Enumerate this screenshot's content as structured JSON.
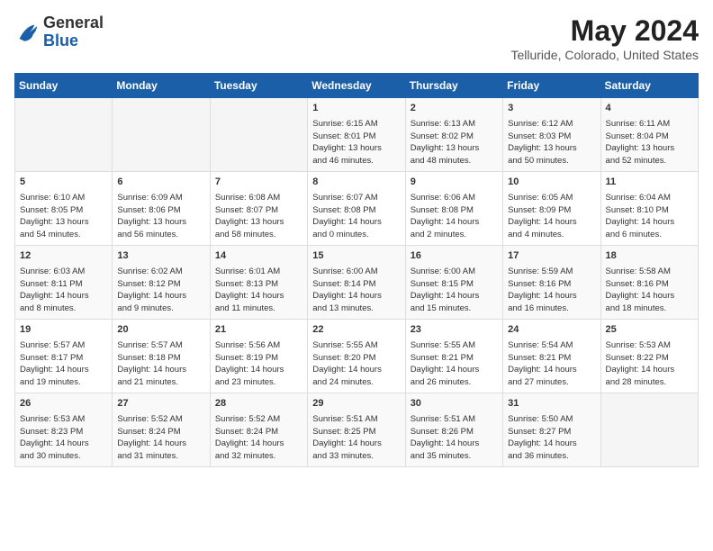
{
  "app": {
    "logo_line1": "General",
    "logo_line2": "Blue",
    "title": "May 2024",
    "subtitle": "Telluride, Colorado, United States"
  },
  "calendar": {
    "headers": [
      "Sunday",
      "Monday",
      "Tuesday",
      "Wednesday",
      "Thursday",
      "Friday",
      "Saturday"
    ],
    "weeks": [
      [
        {
          "day": "",
          "info": ""
        },
        {
          "day": "",
          "info": ""
        },
        {
          "day": "",
          "info": ""
        },
        {
          "day": "1",
          "info": "Sunrise: 6:15 AM\nSunset: 8:01 PM\nDaylight: 13 hours\nand 46 minutes."
        },
        {
          "day": "2",
          "info": "Sunrise: 6:13 AM\nSunset: 8:02 PM\nDaylight: 13 hours\nand 48 minutes."
        },
        {
          "day": "3",
          "info": "Sunrise: 6:12 AM\nSunset: 8:03 PM\nDaylight: 13 hours\nand 50 minutes."
        },
        {
          "day": "4",
          "info": "Sunrise: 6:11 AM\nSunset: 8:04 PM\nDaylight: 13 hours\nand 52 minutes."
        }
      ],
      [
        {
          "day": "5",
          "info": "Sunrise: 6:10 AM\nSunset: 8:05 PM\nDaylight: 13 hours\nand 54 minutes."
        },
        {
          "day": "6",
          "info": "Sunrise: 6:09 AM\nSunset: 8:06 PM\nDaylight: 13 hours\nand 56 minutes."
        },
        {
          "day": "7",
          "info": "Sunrise: 6:08 AM\nSunset: 8:07 PM\nDaylight: 13 hours\nand 58 minutes."
        },
        {
          "day": "8",
          "info": "Sunrise: 6:07 AM\nSunset: 8:08 PM\nDaylight: 14 hours\nand 0 minutes."
        },
        {
          "day": "9",
          "info": "Sunrise: 6:06 AM\nSunset: 8:08 PM\nDaylight: 14 hours\nand 2 minutes."
        },
        {
          "day": "10",
          "info": "Sunrise: 6:05 AM\nSunset: 8:09 PM\nDaylight: 14 hours\nand 4 minutes."
        },
        {
          "day": "11",
          "info": "Sunrise: 6:04 AM\nSunset: 8:10 PM\nDaylight: 14 hours\nand 6 minutes."
        }
      ],
      [
        {
          "day": "12",
          "info": "Sunrise: 6:03 AM\nSunset: 8:11 PM\nDaylight: 14 hours\nand 8 minutes."
        },
        {
          "day": "13",
          "info": "Sunrise: 6:02 AM\nSunset: 8:12 PM\nDaylight: 14 hours\nand 9 minutes."
        },
        {
          "day": "14",
          "info": "Sunrise: 6:01 AM\nSunset: 8:13 PM\nDaylight: 14 hours\nand 11 minutes."
        },
        {
          "day": "15",
          "info": "Sunrise: 6:00 AM\nSunset: 8:14 PM\nDaylight: 14 hours\nand 13 minutes."
        },
        {
          "day": "16",
          "info": "Sunrise: 6:00 AM\nSunset: 8:15 PM\nDaylight: 14 hours\nand 15 minutes."
        },
        {
          "day": "17",
          "info": "Sunrise: 5:59 AM\nSunset: 8:16 PM\nDaylight: 14 hours\nand 16 minutes."
        },
        {
          "day": "18",
          "info": "Sunrise: 5:58 AM\nSunset: 8:16 PM\nDaylight: 14 hours\nand 18 minutes."
        }
      ],
      [
        {
          "day": "19",
          "info": "Sunrise: 5:57 AM\nSunset: 8:17 PM\nDaylight: 14 hours\nand 19 minutes."
        },
        {
          "day": "20",
          "info": "Sunrise: 5:57 AM\nSunset: 8:18 PM\nDaylight: 14 hours\nand 21 minutes."
        },
        {
          "day": "21",
          "info": "Sunrise: 5:56 AM\nSunset: 8:19 PM\nDaylight: 14 hours\nand 23 minutes."
        },
        {
          "day": "22",
          "info": "Sunrise: 5:55 AM\nSunset: 8:20 PM\nDaylight: 14 hours\nand 24 minutes."
        },
        {
          "day": "23",
          "info": "Sunrise: 5:55 AM\nSunset: 8:21 PM\nDaylight: 14 hours\nand 26 minutes."
        },
        {
          "day": "24",
          "info": "Sunrise: 5:54 AM\nSunset: 8:21 PM\nDaylight: 14 hours\nand 27 minutes."
        },
        {
          "day": "25",
          "info": "Sunrise: 5:53 AM\nSunset: 8:22 PM\nDaylight: 14 hours\nand 28 minutes."
        }
      ],
      [
        {
          "day": "26",
          "info": "Sunrise: 5:53 AM\nSunset: 8:23 PM\nDaylight: 14 hours\nand 30 minutes."
        },
        {
          "day": "27",
          "info": "Sunrise: 5:52 AM\nSunset: 8:24 PM\nDaylight: 14 hours\nand 31 minutes."
        },
        {
          "day": "28",
          "info": "Sunrise: 5:52 AM\nSunset: 8:24 PM\nDaylight: 14 hours\nand 32 minutes."
        },
        {
          "day": "29",
          "info": "Sunrise: 5:51 AM\nSunset: 8:25 PM\nDaylight: 14 hours\nand 33 minutes."
        },
        {
          "day": "30",
          "info": "Sunrise: 5:51 AM\nSunset: 8:26 PM\nDaylight: 14 hours\nand 35 minutes."
        },
        {
          "day": "31",
          "info": "Sunrise: 5:50 AM\nSunset: 8:27 PM\nDaylight: 14 hours\nand 36 minutes."
        },
        {
          "day": "",
          "info": ""
        }
      ]
    ]
  }
}
